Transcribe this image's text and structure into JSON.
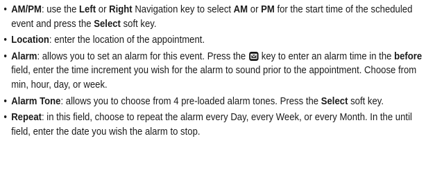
{
  "items": [
    {
      "term": "AM/PM",
      "t1": ": use the ",
      "k1": "Left",
      "t2": " or ",
      "k2": "Right",
      "t3": " Navigation key to select ",
      "k3": "AM",
      "t4": " or ",
      "k4": "PM",
      "t5": " for the start time of the scheduled event and press the ",
      "k5": "Select",
      "t6": " soft key."
    },
    {
      "term": "Location",
      "t1": ": enter the location of the appointment."
    },
    {
      "term": "Alarm",
      "t1": ": allows you to set an alarm for this event. Press the ",
      "icon": "message-key-icon",
      "t2": " key to enter an alarm time in the ",
      "k1": "before",
      "t3": " field, enter the time increment you wish for the alarm to sound prior to the appointment. Choose from min, hour, day, or week."
    },
    {
      "term": "Alarm Tone",
      "t1": ": allows you to choose from 4 pre-loaded alarm tones. Press the ",
      "k1": "Select",
      "t2": " soft key."
    },
    {
      "term": "Repeat",
      "t1": ": in this field, choose to repeat the alarm every Day, every Week, or every Month. In the until field, enter the date you wish the alarm to stop."
    }
  ],
  "bullet_glyph": "•"
}
